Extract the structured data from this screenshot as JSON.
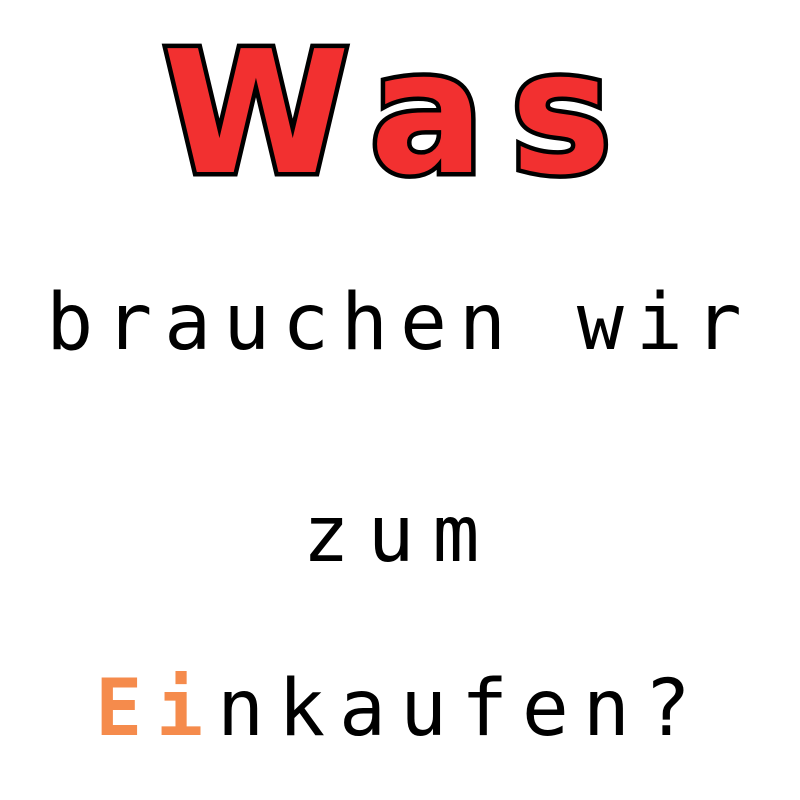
{
  "headline": "Was",
  "line1": "brauchen wir",
  "line2": "zum",
  "line3": {
    "highlight": "Ei",
    "rest": "nkaufen?"
  },
  "colors": {
    "headline_fill": "#f23030",
    "headline_outline": "#000000",
    "highlight": "#f58b4c",
    "text": "#000000",
    "background": "#ffffff"
  }
}
